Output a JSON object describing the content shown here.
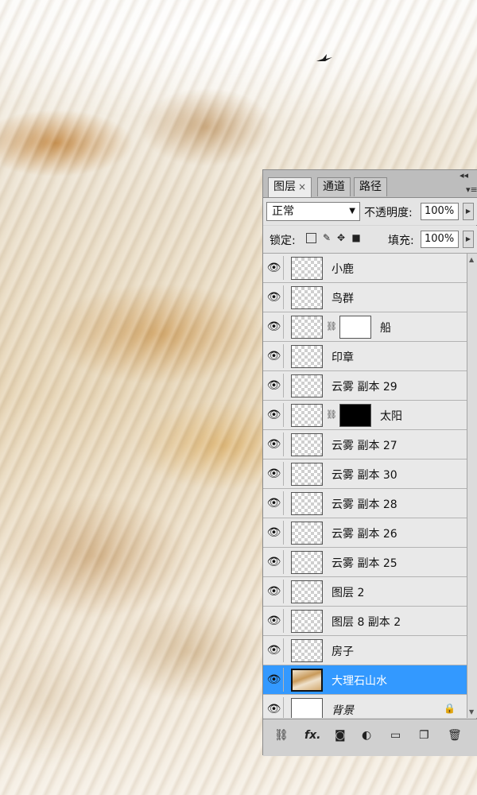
{
  "panel": {
    "tabs": [
      {
        "label": "图层",
        "active": true,
        "close_glyph": "×"
      },
      {
        "label": "通道",
        "active": false
      },
      {
        "label": "路径",
        "active": false
      }
    ],
    "blend_mode": "正常",
    "opacity_label": "不透明度:",
    "opacity_value": "100%",
    "lock_label": "锁定:",
    "fill_label": "填充:",
    "fill_value": "100%",
    "layers": [
      {
        "name": "小鹿",
        "visible": true,
        "thumb": "transparent"
      },
      {
        "name": "鸟群",
        "visible": true,
        "thumb": "transparent"
      },
      {
        "name": "船",
        "visible": true,
        "thumb": "transparent",
        "mask": "white"
      },
      {
        "name": "印章",
        "visible": true,
        "thumb": "transparent"
      },
      {
        "name": "云雾 副本 29",
        "visible": true,
        "thumb": "transparent"
      },
      {
        "name": "太阳",
        "visible": true,
        "thumb": "transparent",
        "mask": "black"
      },
      {
        "name": "云雾 副本 27",
        "visible": true,
        "thumb": "transparent"
      },
      {
        "name": "云雾 副本 30",
        "visible": true,
        "thumb": "transparent"
      },
      {
        "name": "云雾 副本 28",
        "visible": true,
        "thumb": "transparent"
      },
      {
        "name": "云雾 副本 26",
        "visible": true,
        "thumb": "transparent"
      },
      {
        "name": "云雾 副本 25",
        "visible": true,
        "thumb": "transparent"
      },
      {
        "name": "图层 2",
        "visible": true,
        "thumb": "transparent"
      },
      {
        "name": "图层 8 副本 2",
        "visible": true,
        "thumb": "transparent"
      },
      {
        "name": "房子",
        "visible": true,
        "thumb": "transparent"
      },
      {
        "name": "大理石山水",
        "visible": true,
        "thumb": "marble",
        "selected": true
      },
      {
        "name": "背景",
        "visible": true,
        "thumb": "white",
        "locked": true,
        "italic": true
      }
    ],
    "footer_icons": [
      "link-layers-icon",
      "fx-icon",
      "add-mask-icon",
      "adjustment-layer-icon",
      "new-group-icon",
      "new-layer-icon",
      "trash-icon"
    ],
    "colors": {
      "selection": "#3399ff",
      "panel_bg": "#d6d6d6"
    }
  }
}
